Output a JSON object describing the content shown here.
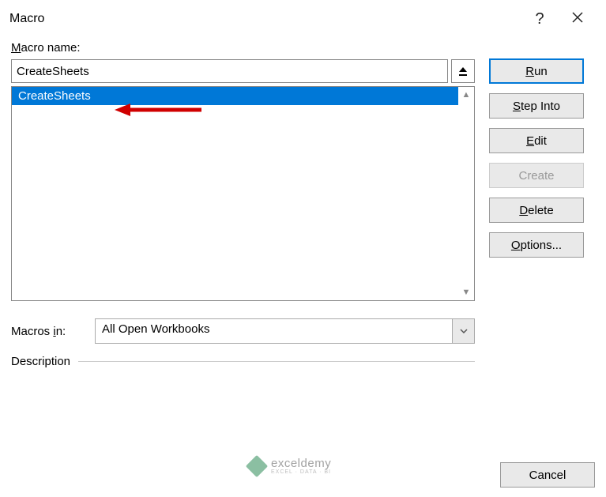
{
  "dialog": {
    "title": "Macro"
  },
  "labels": {
    "macro_name": "acro name:",
    "macro_name_prefix": "M",
    "macros_in": "Macros in:",
    "macros_in_underline": "i",
    "description": "Description"
  },
  "inputs": {
    "macro_name_value": "CreateSheets"
  },
  "list": {
    "items": [
      "CreateSheets"
    ],
    "selected_index": 0
  },
  "dropdown": {
    "macros_in_value": "All Open Workbooks"
  },
  "buttons": {
    "run": "Run",
    "run_prefix": "R",
    "run_suffix": "un",
    "step_into": "tep Into",
    "step_into_prefix": "S",
    "edit": "dit",
    "edit_prefix": "E",
    "create": "Create",
    "create_prefix": "C",
    "create_suffix": "reate",
    "delete": "elete",
    "delete_prefix": "D",
    "options": "ptions...",
    "options_prefix": "O",
    "cancel": "Cancel"
  },
  "watermark": {
    "main": "exceldemy",
    "sub": "EXCEL · DATA · BI"
  }
}
